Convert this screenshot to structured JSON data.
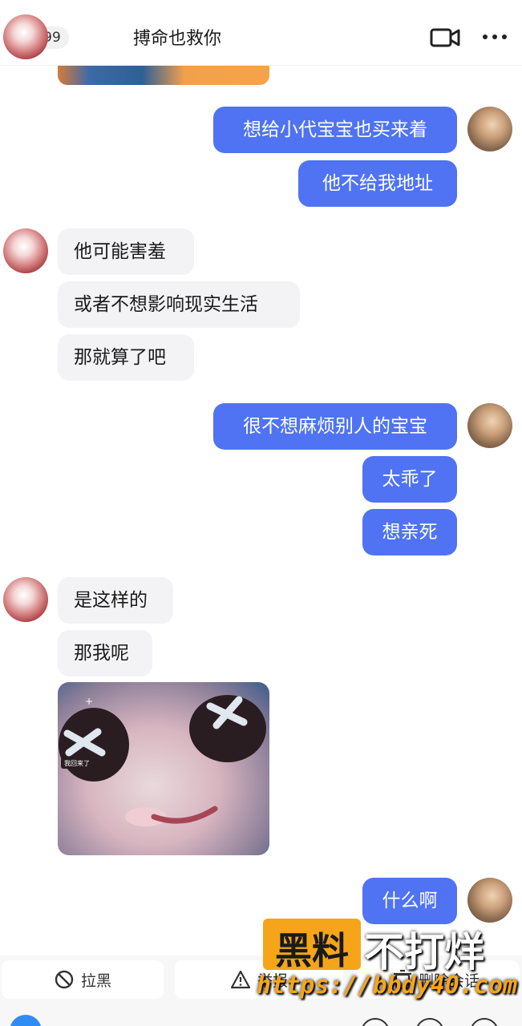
{
  "header": {
    "unread_count": "99",
    "contact_name": "搏命也救你"
  },
  "messages": [
    {
      "side": "mine",
      "text": "想给小代宝宝也买来着"
    },
    {
      "side": "mine",
      "text": "他不给我地址"
    },
    {
      "side": "theirs",
      "text": "他可能害羞"
    },
    {
      "side": "theirs",
      "text": "或者不想影响现实生活"
    },
    {
      "side": "theirs",
      "text": "那就算了吧"
    },
    {
      "side": "mine",
      "text": "很不想麻烦别人的宝宝"
    },
    {
      "side": "mine",
      "text": "太乖了"
    },
    {
      "side": "mine",
      "text": "想亲死"
    },
    {
      "side": "theirs",
      "text": "是这样的"
    },
    {
      "side": "theirs",
      "text": "那我呢"
    },
    {
      "side": "theirs",
      "type": "image",
      "caption": "我回来了"
    },
    {
      "side": "mine",
      "text": "什么啊"
    }
  ],
  "actions": {
    "block": "拉黑",
    "report": "举报",
    "delete": "删除会话"
  },
  "watermark": {
    "brand": "黑料",
    "slogan": "不打烊",
    "url": "https://bbdy40.com"
  },
  "colors": {
    "my_bubble": "#4f73f2",
    "their_bubble": "#f3f3f5",
    "watermark": "#f6a51a"
  }
}
